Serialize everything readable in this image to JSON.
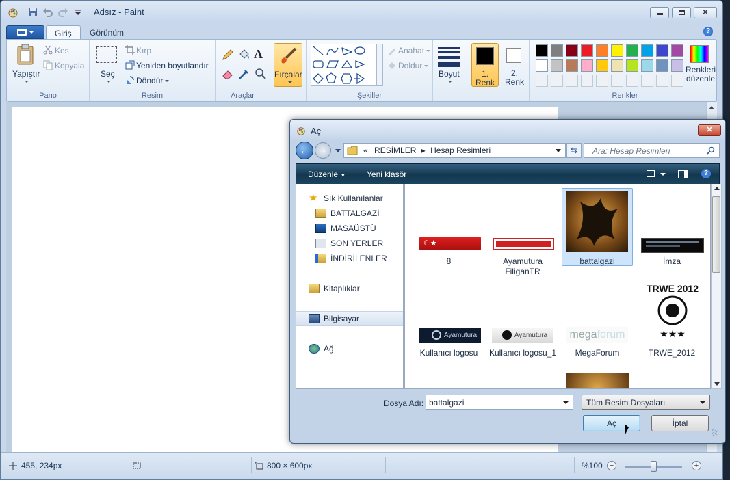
{
  "app": {
    "title": "Adsız - Paint"
  },
  "ribbon": {
    "tabs": [
      "Giriş",
      "Görünüm"
    ],
    "pano": {
      "label": "Pano",
      "paste": "Yapıştır",
      "cut": "Kes",
      "copy": "Kopyala"
    },
    "resim": {
      "label": "Resim",
      "select": "Seç",
      "crop": "Kırp",
      "resize": "Yeniden boyutlandır",
      "rotate": "Döndür"
    },
    "araclar": {
      "label": "Araçlar"
    },
    "brushes": "Fırçalar",
    "sekiller": {
      "label": "Şekiller",
      "outline": "Anahat",
      "fill": "Doldur"
    },
    "size": "Boyut",
    "color1": "1. Renk",
    "color2": "2. Renk",
    "renkler": {
      "label": "Renkler",
      "edit": "Renkleri düzenle"
    },
    "palette_row1": [
      "#000000",
      "#7f7f7f",
      "#880015",
      "#ed1c24",
      "#ff7f27",
      "#fff200",
      "#22b14c",
      "#00a2e8",
      "#3f48cc",
      "#a349a4"
    ],
    "palette_row2": [
      "#ffffff",
      "#c3c3c3",
      "#b97a57",
      "#ffaec9",
      "#ffc90e",
      "#efe4b0",
      "#b5e61d",
      "#99d9ea",
      "#7092be",
      "#c8bfe7"
    ]
  },
  "status": {
    "cursor_pos": "455, 234px",
    "image_size": "800 × 600px",
    "zoom": "%100"
  },
  "dialog": {
    "title": "Aç",
    "breadcrumb_prefix": "«",
    "breadcrumb": [
      "RESİMLER",
      "Hesap Resimleri"
    ],
    "search_placeholder": "Ara: Hesap Resimleri",
    "toolbar": {
      "organize": "Düzenle",
      "new_folder": "Yeni klasör"
    },
    "nav": {
      "favorites": "Sık Kullanılanlar",
      "fav_items": [
        "BATTALGAZİ",
        "MASAÜSTÜ",
        "SON YERLER",
        "İNDİRİLENLER"
      ],
      "libraries": "Kitaplıklar",
      "computer": "Bilgisayar",
      "network": "Ağ"
    },
    "files": [
      {
        "name": "8"
      },
      {
        "name": "Ayamutura FiliganTR"
      },
      {
        "name": "battalgazi"
      },
      {
        "name": "İmza"
      },
      {
        "name": "Kullanıcı logosu"
      },
      {
        "name": "Kullanıcı logosu_1"
      },
      {
        "name": "MegaForum"
      },
      {
        "name": "TRWE_2012"
      }
    ],
    "thumb_text": {
      "ayamutura": "Ayamutura",
      "megaforum_a": "mega",
      "megaforum_b": "forum",
      "trwe": "TRWE 2012",
      "stars": "★★★"
    },
    "filename_label": "Dosya Adı:",
    "filename_value": "battalgazi",
    "filetype": "Tüm Resim Dosyaları",
    "open_button": "Aç",
    "cancel_button": "İptal"
  }
}
